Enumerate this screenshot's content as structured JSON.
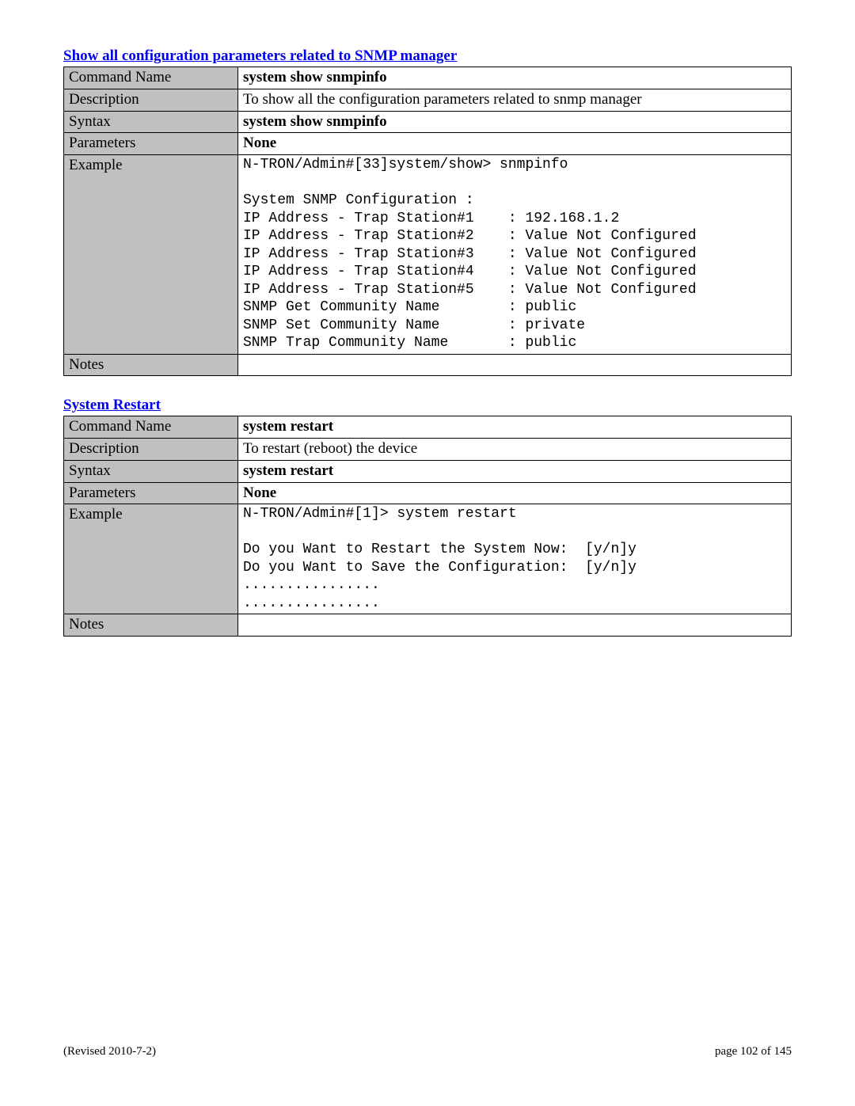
{
  "section1": {
    "title": "Show all configuration parameters related to SNMP manager",
    "rows": {
      "command_name_label": "Command Name",
      "command_name_value": "system show snmpinfo",
      "description_label": "Description",
      "description_value": "To show all the configuration parameters related to snmp manager",
      "syntax_label": "Syntax",
      "syntax_value": "system show snmpinfo",
      "parameters_label": "Parameters",
      "parameters_value": "None",
      "example_label": "Example",
      "example_value": "N-TRON/Admin#[33]system/show> snmpinfo\n\nSystem SNMP Configuration :\nIP Address - Trap Station#1    : 192.168.1.2\nIP Address - Trap Station#2    : Value Not Configured\nIP Address - Trap Station#3    : Value Not Configured\nIP Address - Trap Station#4    : Value Not Configured\nIP Address - Trap Station#5    : Value Not Configured\nSNMP Get Community Name        : public\nSNMP Set Community Name        : private\nSNMP Trap Community Name       : public",
      "notes_label": "Notes",
      "notes_value": ""
    }
  },
  "section2": {
    "title": "System Restart",
    "rows": {
      "command_name_label": "Command Name",
      "command_name_value": "system  restart",
      "description_label": "Description",
      "description_value": "To restart (reboot) the device",
      "syntax_label": "Syntax",
      "syntax_value": "system restart",
      "parameters_label": "Parameters",
      "parameters_value": "None",
      "example_label": "Example",
      "example_value": "N-TRON/Admin#[1]> system restart\n\nDo you Want to Restart the System Now:  [y/n]y\nDo you Want to Save the Configuration:  [y/n]y\n................\n................",
      "notes_label": "Notes",
      "notes_value": ""
    }
  },
  "footer": {
    "left": "(Revised 2010-7-2)",
    "right": "page 102 of 145"
  }
}
